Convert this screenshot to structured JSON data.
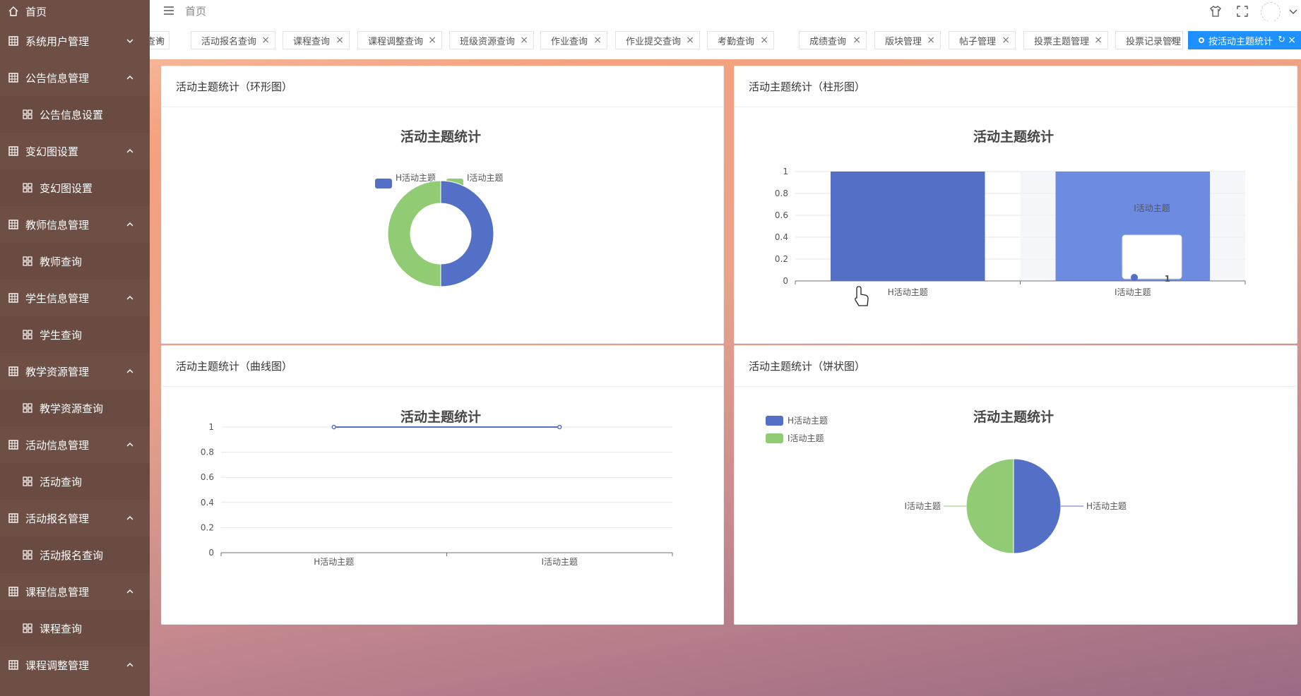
{
  "sidebar": {
    "home": "首页",
    "groups": [
      {
        "label": "系统用户管理",
        "expanded": false
      },
      {
        "label": "公告信息管理",
        "expanded": true,
        "sub": "公告信息设置"
      },
      {
        "label": "变幻图设置",
        "expanded": true,
        "sub": "变幻图设置"
      },
      {
        "label": "教师信息管理",
        "expanded": true,
        "sub": "教师查询"
      },
      {
        "label": "学生信息管理",
        "expanded": true,
        "sub": "学生查询"
      },
      {
        "label": "教学资源管理",
        "expanded": true,
        "sub": "教学资源查询"
      },
      {
        "label": "活动信息管理",
        "expanded": true,
        "sub": "活动查询"
      },
      {
        "label": "活动报名管理",
        "expanded": true,
        "sub": "活动报名查询"
      },
      {
        "label": "课程信息管理",
        "expanded": true,
        "sub": "课程查询"
      },
      {
        "label": "课程调整管理",
        "expanded": true
      }
    ]
  },
  "header": {
    "breadcrumb": "首页"
  },
  "tabs": [
    {
      "label": "查询"
    },
    {
      "label": "活动报名查询"
    },
    {
      "label": "课程查询"
    },
    {
      "label": "课程调整查询"
    },
    {
      "label": "班级资源查询"
    },
    {
      "label": "作业查询"
    },
    {
      "label": "作业提交查询"
    },
    {
      "label": "考勤查询"
    },
    {
      "label": "成绩查询"
    },
    {
      "label": "版块管理"
    },
    {
      "label": "帖子管理"
    },
    {
      "label": "投票主题管理"
    },
    {
      "label": "投票记录管理"
    },
    {
      "label": "按活动主题统计",
      "active": true
    }
  ],
  "colors": {
    "blue": "#5470c6",
    "green": "#91cc75",
    "tab_active": "#1e90ff",
    "sidebar": "#6d4f45"
  },
  "cards": {
    "donut": {
      "heading": "活动主题统计（环形图）"
    },
    "bar": {
      "heading": "活动主题统计（柱形图）"
    },
    "line": {
      "heading": "活动主题统计（曲线图）"
    },
    "pie": {
      "heading": "活动主题统计（饼状图）"
    }
  },
  "tooltip": {
    "name": "I活动主题",
    "value": "1"
  },
  "chart_data": [
    {
      "type": "pie",
      "variant": "donut",
      "title": "活动主题统计",
      "legend": "top",
      "categories": [
        "H活动主题",
        "I活动主题"
      ],
      "values": [
        1,
        1
      ]
    },
    {
      "type": "bar",
      "title": "活动主题统计",
      "categories": [
        "H活动主题",
        "I活动主题"
      ],
      "values": [
        1,
        1
      ],
      "ylim": [
        0,
        1
      ],
      "yticks": [
        "0",
        "0.2",
        "0.4",
        "0.6",
        "0.8",
        "1"
      ]
    },
    {
      "type": "line",
      "title": "活动主题统计",
      "categories": [
        "H活动主题",
        "I活动主题"
      ],
      "values": [
        1,
        1
      ],
      "ylim": [
        0,
        1
      ],
      "yticks": [
        "0",
        "0.2",
        "0.4",
        "0.6",
        "0.8",
        "1"
      ]
    },
    {
      "type": "pie",
      "title": "活动主题统计",
      "legend": "top-left",
      "categories": [
        "H活动主题",
        "I活动主题"
      ],
      "values": [
        1,
        1
      ]
    }
  ]
}
